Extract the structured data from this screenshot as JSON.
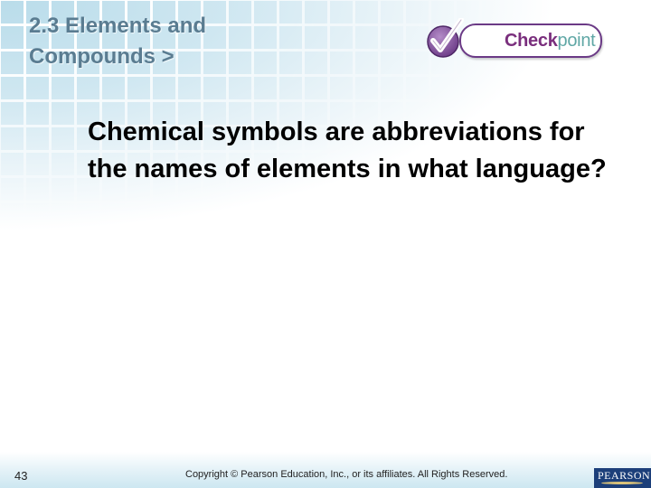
{
  "slide": {
    "section_title": "2.3 Elements and\nCompounds >",
    "checkpoint_badge": {
      "label_primary": "Check",
      "label_secondary": "point",
      "icon": "checkmark-icon",
      "colors": {
        "primary": "#7a2f7d",
        "secondary": "#5fa7a5",
        "border": "#6b3a86"
      }
    },
    "question": "Chemical symbols are abbreviations for the names of elements in what language?",
    "footer": {
      "page_number": "43",
      "copyright": "Copyright © Pearson Education, Inc., or its affiliates. All Rights Reserved.",
      "publisher_logo": "PEARSON"
    }
  }
}
